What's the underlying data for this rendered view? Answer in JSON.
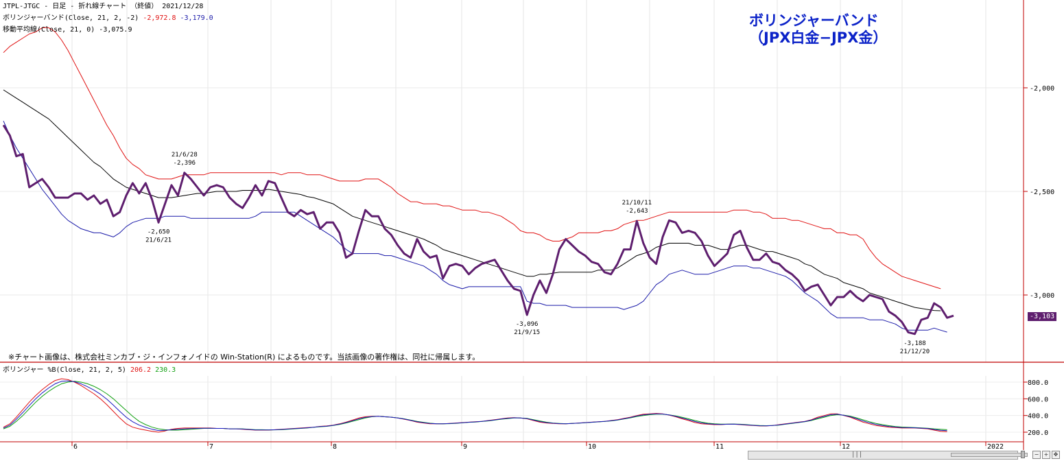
{
  "header": {
    "line1": "JTPL-JTGC - 日足 - 折れ線チャート （終値） 2021/12/28",
    "bb_label": "ボリンジャーバンド(Close, 21, 2, -2)",
    "bb_upper": "-2,972.8",
    "bb_lower": "-3,179.0",
    "ma_label": "移動平均線(Close, 21, 0) -3,075.9"
  },
  "overlay_title": {
    "line1": "ボリンジャーバンド",
    "line2": "（JPX白金−JPX金）"
  },
  "copyright": "※チャート画像は、株式会社ミンカブ・ジ・インフォノイドの Win-Station(R) によるものです。当該画像の著作権は、同社に帰属します。",
  "lower_panel": {
    "label": "ボリンジャー %B(Close, 21, 2, 5)",
    "value_red": "206.2",
    "value_green": "230.3"
  },
  "last_value_badge": "-3,103",
  "scrollbar_grip": "|||",
  "toolbar": {
    "zoom_out": "−",
    "zoom_in": "+",
    "fit": "✥"
  },
  "colors": {
    "price": "#5e1e6e",
    "upper": "#e01010",
    "lower": "#1818a8",
    "ma": "#000000",
    "pb_red": "#e01010",
    "pb_green": "#10a010",
    "pb_blue": "#1818c0",
    "separator": "#c00000",
    "title": "#0b22c8"
  },
  "chart_data": [
    {
      "type": "line",
      "x_start": "2021-05-14",
      "x_step_days": 1,
      "x_note": "trading days from mid-May 2021 to 2021-12-28",
      "ylim": [
        -3300,
        -1700
      ],
      "y_ticks": [
        "-2,000",
        "-2,500",
        "-3,000"
      ],
      "x_ticks": [
        "6",
        "7",
        "8",
        "9",
        "10",
        "11",
        "12",
        "2022"
      ],
      "series": [
        {
          "name": "Close",
          "values": [
            -2180,
            -2230,
            -2330,
            -2320,
            -2480,
            -2460,
            -2440,
            -2480,
            -2530,
            -2530,
            -2530,
            -2510,
            -2510,
            -2540,
            -2520,
            -2560,
            -2540,
            -2620,
            -2600,
            -2520,
            -2460,
            -2510,
            -2460,
            -2540,
            -2650,
            -2560,
            -2470,
            -2520,
            -2410,
            -2440,
            -2480,
            -2520,
            -2480,
            -2470,
            -2480,
            -2530,
            -2560,
            -2580,
            -2530,
            -2470,
            -2520,
            -2450,
            -2460,
            -2530,
            -2600,
            -2620,
            -2590,
            -2610,
            -2600,
            -2680,
            -2650,
            -2650,
            -2700,
            -2820,
            -2800,
            -2690,
            -2590,
            -2620,
            -2620,
            -2680,
            -2710,
            -2760,
            -2800,
            -2820,
            -2730,
            -2790,
            -2820,
            -2810,
            -2920,
            -2860,
            -2850,
            -2860,
            -2900,
            -2870,
            -2850,
            -2840,
            -2830,
            -2880,
            -2930,
            -2970,
            -2980,
            -3096,
            -3000,
            -2930,
            -2990,
            -2900,
            -2780,
            -2730,
            -2760,
            -2790,
            -2810,
            -2840,
            -2850,
            -2890,
            -2900,
            -2850,
            -2780,
            -2780,
            -2643,
            -2750,
            -2820,
            -2850,
            -2720,
            -2640,
            -2650,
            -2700,
            -2690,
            -2700,
            -2740,
            -2810,
            -2860,
            -2830,
            -2800,
            -2710,
            -2690,
            -2770,
            -2830,
            -2830,
            -2800,
            -2840,
            -2850,
            -2880,
            -2900,
            -2930,
            -2980,
            -2960,
            -2950,
            -3000,
            -3050,
            -3010,
            -3010,
            -2980,
            -3010,
            -3030,
            -3000,
            -3010,
            -3020,
            -3080,
            -3100,
            -3130,
            -3180,
            -3188,
            -3120,
            -3110,
            -3040,
            -3060,
            -3110,
            -3100
          ],
          "labels": [
            {
              "i": 24,
              "date": "21/6/21",
              "value": "-2,650",
              "pos": "below"
            },
            {
              "i": 28,
              "date": "21/6/28",
              "value": "-2,396",
              "pos": "above"
            },
            {
              "i": 81,
              "date": "21/9/15",
              "value": "-3,096",
              "pos": "below"
            },
            {
              "i": 98,
              "date": "21/10/11",
              "value": "-2,643",
              "pos": "above"
            },
            {
              "i": 141,
              "date": "21/12/20",
              "value": "-3,188",
              "pos": "below"
            }
          ]
        },
        {
          "name": "Upper Band",
          "values": [
            -1830,
            -1800,
            -1780,
            -1760,
            -1740,
            -1730,
            -1710,
            -1710,
            -1730,
            -1770,
            -1820,
            -1880,
            -1940,
            -2000,
            -2060,
            -2120,
            -2180,
            -2230,
            -2290,
            -2340,
            -2370,
            -2390,
            -2420,
            -2430,
            -2440,
            -2440,
            -2440,
            -2430,
            -2420,
            -2420,
            -2420,
            -2420,
            -2410,
            -2410,
            -2410,
            -2410,
            -2410,
            -2410,
            -2410,
            -2410,
            -2410,
            -2410,
            -2410,
            -2420,
            -2410,
            -2410,
            -2410,
            -2420,
            -2420,
            -2420,
            -2430,
            -2440,
            -2450,
            -2450,
            -2450,
            -2450,
            -2440,
            -2440,
            -2440,
            -2460,
            -2480,
            -2510,
            -2530,
            -2550,
            -2550,
            -2560,
            -2560,
            -2560,
            -2570,
            -2570,
            -2580,
            -2590,
            -2590,
            -2590,
            -2600,
            -2600,
            -2610,
            -2620,
            -2640,
            -2660,
            -2690,
            -2700,
            -2700,
            -2710,
            -2730,
            -2740,
            -2740,
            -2730,
            -2720,
            -2700,
            -2700,
            -2700,
            -2700,
            -2690,
            -2690,
            -2680,
            -2660,
            -2650,
            -2640,
            -2640,
            -2630,
            -2620,
            -2610,
            -2600,
            -2600,
            -2600,
            -2600,
            -2600,
            -2600,
            -2600,
            -2600,
            -2600,
            -2600,
            -2590,
            -2590,
            -2590,
            -2600,
            -2600,
            -2610,
            -2630,
            -2630,
            -2630,
            -2640,
            -2640,
            -2650,
            -2660,
            -2670,
            -2680,
            -2680,
            -2700,
            -2700,
            -2710,
            -2710,
            -2730,
            -2780,
            -2820,
            -2850,
            -2870,
            -2890,
            -2910,
            -2920,
            -2930,
            -2940,
            -2950,
            -2960,
            -2970
          ]
        },
        {
          "name": "Moving Average",
          "values": [
            -2010,
            -2030,
            -2050,
            -2070,
            -2090,
            -2110,
            -2130,
            -2150,
            -2180,
            -2210,
            -2240,
            -2270,
            -2300,
            -2330,
            -2360,
            -2380,
            -2410,
            -2440,
            -2460,
            -2480,
            -2490,
            -2500,
            -2510,
            -2520,
            -2530,
            -2530,
            -2530,
            -2525,
            -2520,
            -2515,
            -2510,
            -2510,
            -2505,
            -2500,
            -2500,
            -2500,
            -2500,
            -2495,
            -2495,
            -2495,
            -2495,
            -2490,
            -2495,
            -2500,
            -2505,
            -2510,
            -2515,
            -2525,
            -2530,
            -2540,
            -2550,
            -2560,
            -2580,
            -2600,
            -2620,
            -2630,
            -2640,
            -2650,
            -2660,
            -2670,
            -2680,
            -2690,
            -2700,
            -2710,
            -2720,
            -2730,
            -2745,
            -2760,
            -2780,
            -2790,
            -2800,
            -2810,
            -2820,
            -2830,
            -2840,
            -2850,
            -2860,
            -2870,
            -2880,
            -2890,
            -2900,
            -2910,
            -2910,
            -2900,
            -2900,
            -2895,
            -2890,
            -2890,
            -2890,
            -2890,
            -2890,
            -2890,
            -2880,
            -2880,
            -2880,
            -2870,
            -2850,
            -2830,
            -2810,
            -2800,
            -2790,
            -2770,
            -2760,
            -2750,
            -2750,
            -2750,
            -2750,
            -2760,
            -2760,
            -2760,
            -2770,
            -2780,
            -2780,
            -2770,
            -2760,
            -2760,
            -2770,
            -2780,
            -2790,
            -2790,
            -2800,
            -2810,
            -2820,
            -2830,
            -2850,
            -2860,
            -2880,
            -2900,
            -2910,
            -2920,
            -2940,
            -2950,
            -2960,
            -2970,
            -2990,
            -3000,
            -3010,
            -3020,
            -3030,
            -3040,
            -3050,
            -3060,
            -3065,
            -3070,
            -3075,
            -3076
          ]
        },
        {
          "name": "Lower Band",
          "values": [
            -2160,
            -2230,
            -2290,
            -2340,
            -2390,
            -2440,
            -2490,
            -2530,
            -2570,
            -2610,
            -2640,
            -2660,
            -2680,
            -2690,
            -2700,
            -2700,
            -2710,
            -2720,
            -2700,
            -2670,
            -2650,
            -2640,
            -2630,
            -2630,
            -2630,
            -2620,
            -2620,
            -2620,
            -2620,
            -2630,
            -2630,
            -2630,
            -2630,
            -2630,
            -2630,
            -2630,
            -2630,
            -2630,
            -2630,
            -2620,
            -2600,
            -2600,
            -2600,
            -2600,
            -2600,
            -2600,
            -2620,
            -2640,
            -2660,
            -2680,
            -2700,
            -2720,
            -2750,
            -2780,
            -2800,
            -2800,
            -2800,
            -2800,
            -2800,
            -2810,
            -2810,
            -2820,
            -2830,
            -2840,
            -2850,
            -2860,
            -2880,
            -2900,
            -2930,
            -2950,
            -2960,
            -2970,
            -2960,
            -2960,
            -2960,
            -2960,
            -2960,
            -2960,
            -2960,
            -2960,
            -2960,
            -3030,
            -3040,
            -3040,
            -3050,
            -3050,
            -3050,
            -3050,
            -3060,
            -3060,
            -3060,
            -3060,
            -3060,
            -3060,
            -3060,
            -3060,
            -3070,
            -3060,
            -3050,
            -3030,
            -2990,
            -2950,
            -2930,
            -2900,
            -2890,
            -2880,
            -2890,
            -2900,
            -2900,
            -2900,
            -2890,
            -2880,
            -2870,
            -2860,
            -2860,
            -2860,
            -2870,
            -2870,
            -2880,
            -2890,
            -2900,
            -2910,
            -2930,
            -2960,
            -2990,
            -3010,
            -3030,
            -3060,
            -3090,
            -3110,
            -3110,
            -3110,
            -3110,
            -3110,
            -3120,
            -3120,
            -3120,
            -3130,
            -3140,
            -3160,
            -3170,
            -3170,
            -3170,
            -3170,
            -3160,
            -3170,
            -3179
          ]
        }
      ]
    },
    {
      "type": "line",
      "title": "ボリンジャー %B(Close, 21, 2, 5)",
      "ylim": [
        150,
        900
      ],
      "y_ticks": [
        "800.0",
        "600.0",
        "400.0",
        "200.0"
      ],
      "series": [
        {
          "name": "%B",
          "values": [
            260,
            300,
            380,
            470,
            560,
            640,
            710,
            770,
            820,
            840,
            830,
            800,
            760,
            710,
            660,
            600,
            530,
            450,
            370,
            300,
            260,
            240,
            225,
            210,
            200,
            215,
            235,
            245,
            250,
            250,
            250,
            250,
            250,
            245,
            245,
            240,
            240,
            235,
            230,
            225,
            225,
            225,
            230,
            235,
            240,
            245,
            250,
            255,
            260,
            270,
            275,
            285,
            300,
            320,
            345,
            370,
            385,
            390,
            390,
            385,
            380,
            370,
            355,
            340,
            320,
            310,
            300,
            300,
            300,
            305,
            310,
            315,
            320,
            325,
            330,
            340,
            350,
            360,
            370,
            375,
            370,
            360,
            340,
            320,
            310,
            305,
            300,
            300,
            305,
            310,
            315,
            320,
            325,
            330,
            340,
            350,
            365,
            380,
            400,
            415,
            420,
            425,
            420,
            405,
            385,
            360,
            340,
            315,
            300,
            295,
            290,
            290,
            295,
            295,
            290,
            285,
            280,
            275,
            275,
            280,
            290,
            300,
            310,
            320,
            330,
            350,
            380,
            400,
            420,
            420,
            400,
            380,
            350,
            320,
            300,
            280,
            270,
            260,
            255,
            250,
            250,
            250,
            245,
            240,
            225,
            210,
            206
          ]
        },
        {
          "name": "Signal",
          "values": [
            240,
            270,
            330,
            400,
            480,
            560,
            630,
            690,
            740,
            780,
            800,
            810,
            800,
            780,
            750,
            710,
            660,
            600,
            530,
            460,
            390,
            330,
            290,
            260,
            240,
            230,
            225,
            225,
            230,
            235,
            240,
            245,
            245,
            245,
            245,
            240,
            240,
            240,
            235,
            230,
            230,
            228,
            228,
            230,
            235,
            240,
            245,
            250,
            258,
            265,
            270,
            280,
            292,
            310,
            330,
            350,
            370,
            385,
            390,
            385,
            380,
            372,
            360,
            345,
            330,
            318,
            308,
            302,
            300,
            302,
            306,
            312,
            318,
            322,
            328,
            335,
            345,
            355,
            363,
            370,
            370,
            365,
            350,
            335,
            320,
            310,
            305,
            302,
            304,
            308,
            313,
            318,
            323,
            328,
            335,
            345,
            358,
            372,
            388,
            400,
            410,
            415,
            415,
            408,
            395,
            378,
            360,
            340,
            322,
            308,
            300,
            296,
            296,
            298,
            295,
            290,
            285,
            280,
            278,
            280,
            285,
            295,
            305,
            315,
            325,
            340,
            360,
            380,
            400,
            410,
            405,
            392,
            372,
            348,
            325,
            305,
            290,
            278,
            268,
            262,
            258,
            255,
            252,
            248,
            240,
            235,
            230
          ]
        }
      ]
    }
  ]
}
